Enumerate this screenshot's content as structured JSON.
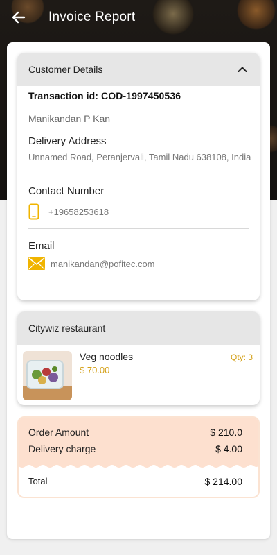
{
  "appbar": {
    "title": "Invoice Report",
    "back_icon": "arrow-left-icon"
  },
  "customer": {
    "header": "Customer Details",
    "transaction": "Transaction id: COD-1997450536",
    "name": "Manikandan P Kan",
    "address_label": "Delivery Address",
    "address": "Unnamed Road, Peranjervali, Tamil Nadu 638108, India",
    "contact_label": "Contact Number",
    "phone": "+19658253618",
    "email_label": "Email",
    "email": "manikandan@pofitec.com"
  },
  "restaurant": {
    "name": "Citywiz restaurant",
    "items": [
      {
        "name": "Veg noodles",
        "price": "$ 70.00",
        "qty": "Qty: 3"
      }
    ]
  },
  "totals": {
    "order_amount_label": "Order Amount",
    "order_amount": "$ 210.0",
    "delivery_label": "Delivery charge",
    "delivery": "$ 4.00",
    "total_label": "Total",
    "total": "$ 214.00"
  },
  "colors": {
    "accent": "#d4a017",
    "totals_bg": "#fde0cf",
    "card_header": "#e6e6e6"
  }
}
